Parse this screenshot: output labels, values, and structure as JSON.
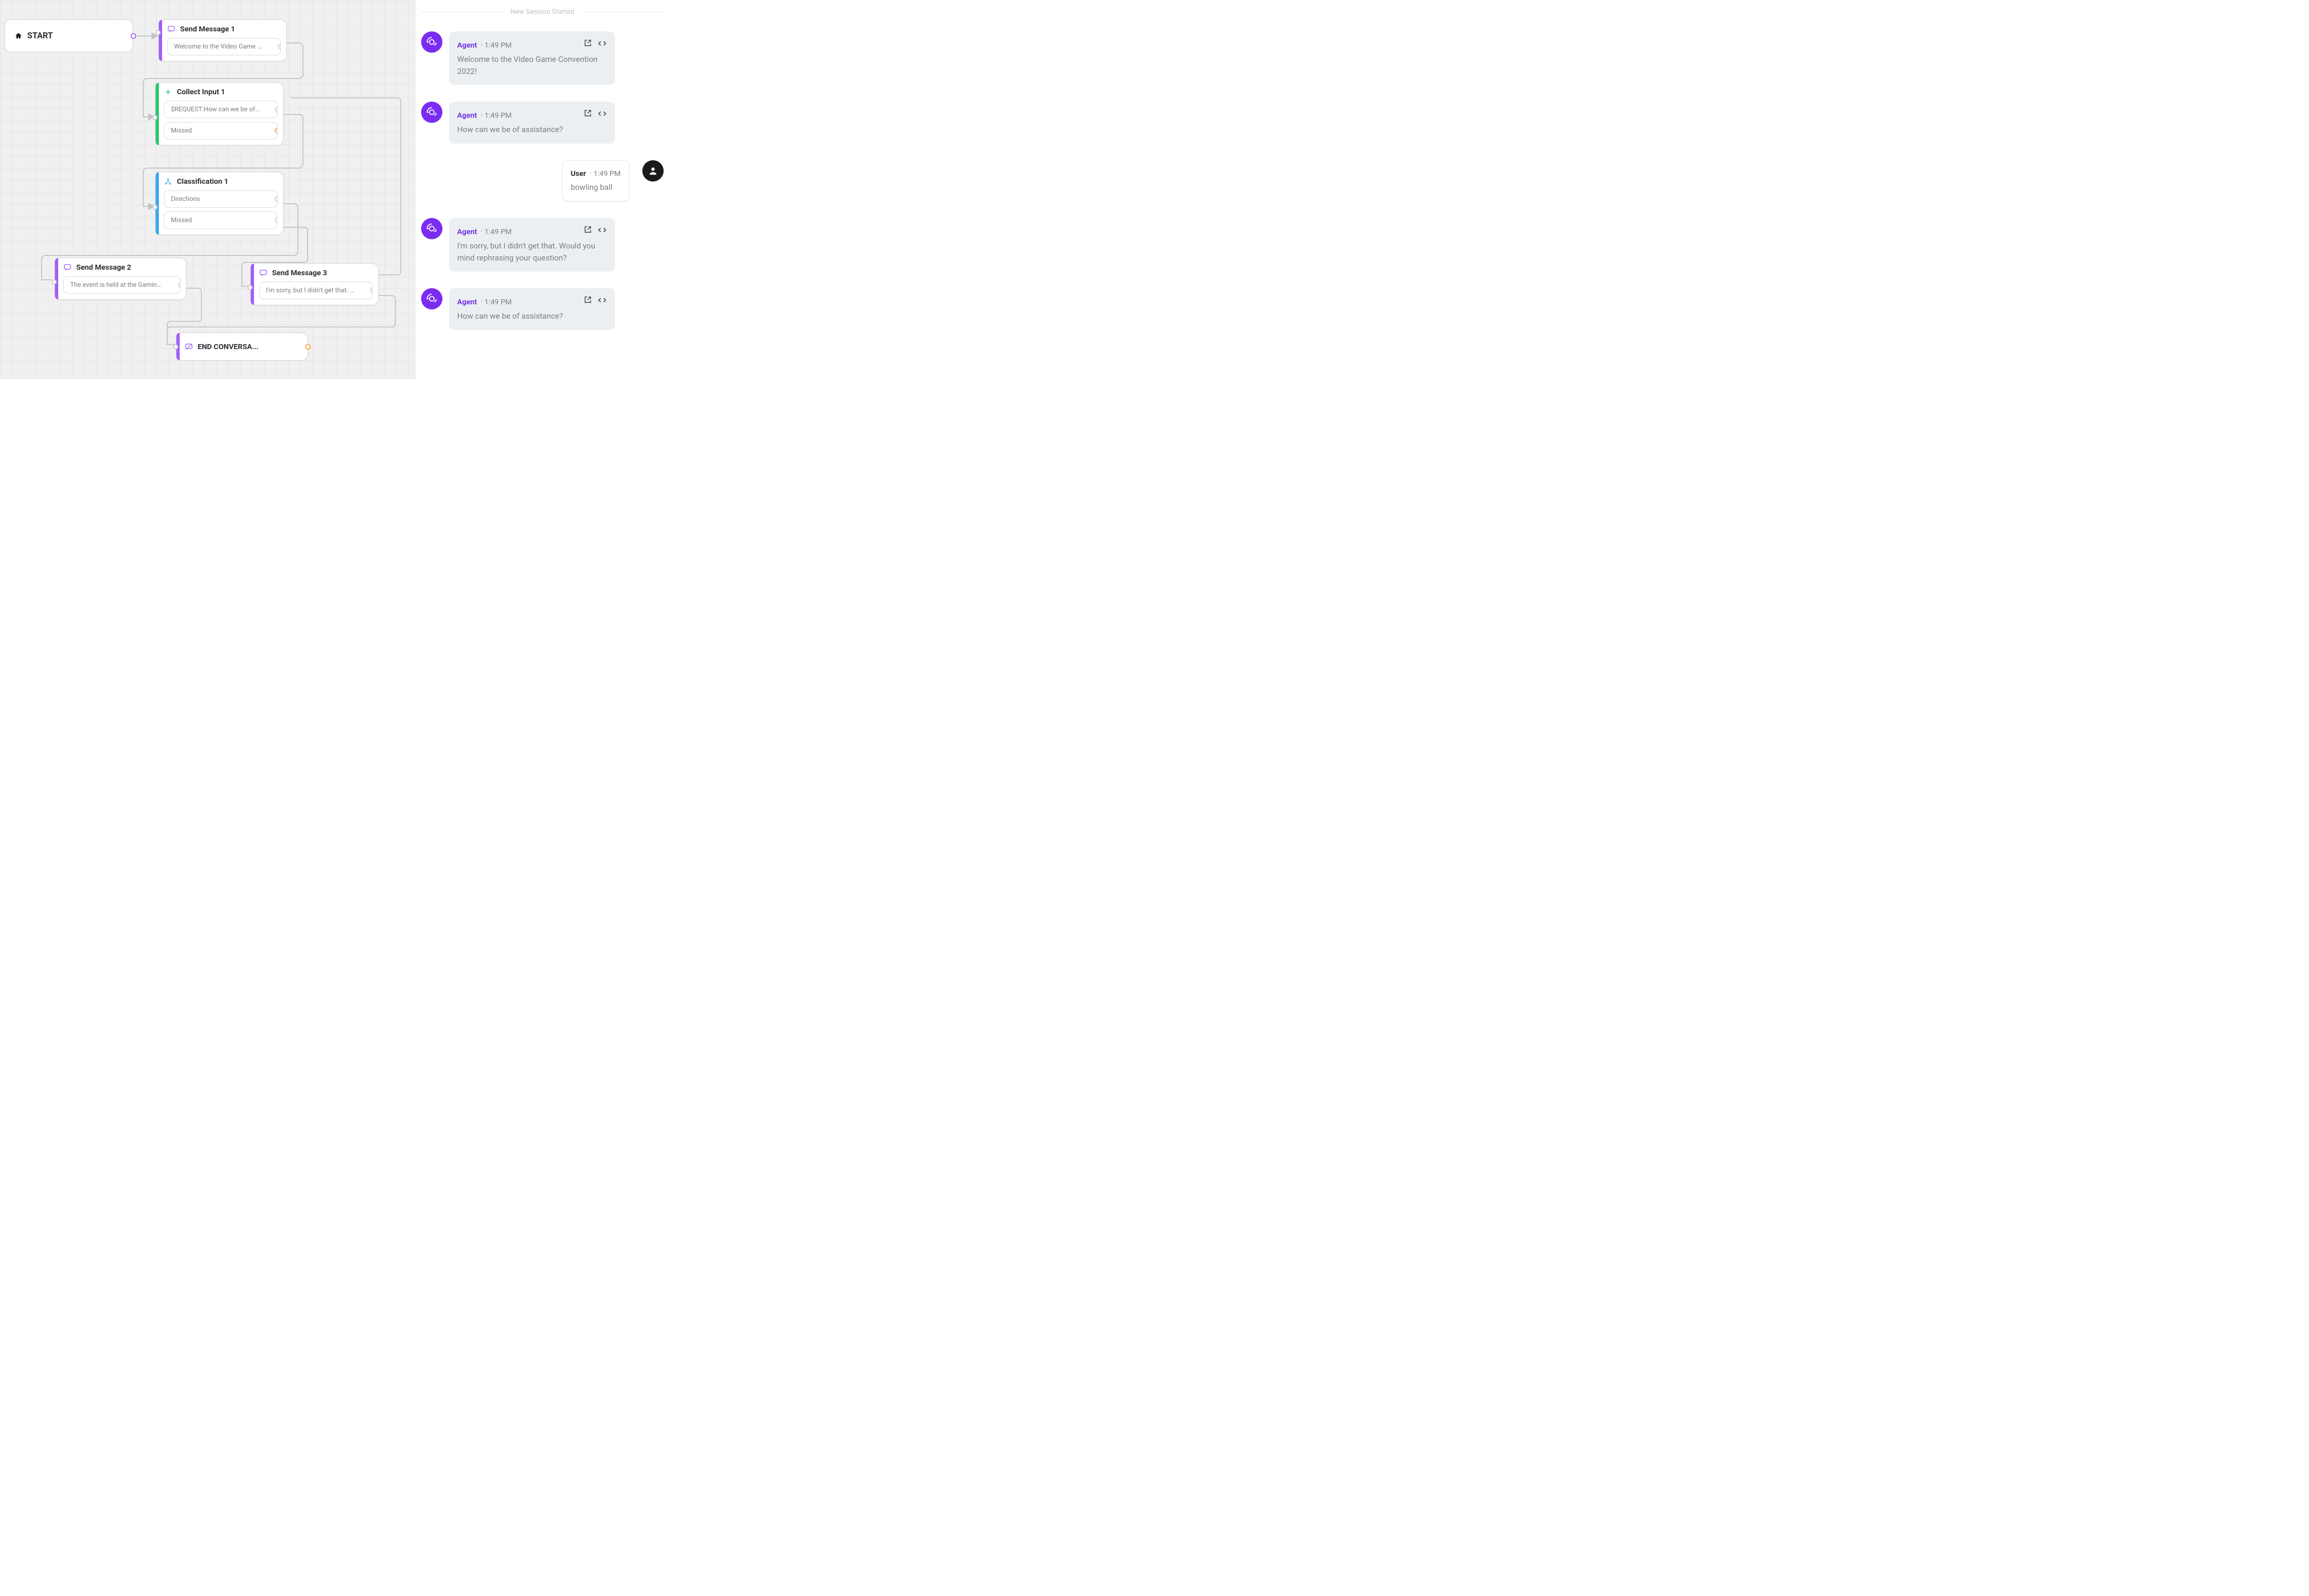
{
  "flow": {
    "start": {
      "label": "START"
    },
    "nodes": {
      "send1": {
        "title": "Send Message 1",
        "field1": "Welcome to the Video Game Co..."
      },
      "collect1": {
        "title": "Collect Input 1",
        "field1": "$REQUEST:How can we be of assis",
        "field2": "Missed"
      },
      "class1": {
        "title": "Classification 1",
        "field1": "Directions",
        "field2": "Missed"
      },
      "send2": {
        "title": "Send Message 2",
        "field1": "The event is held at the Gaming..."
      },
      "send3": {
        "title": "Send Message 3",
        "field1": "I'm sorry, but I didn't get that. ..."
      },
      "end": {
        "title": "END CONVERSA..."
      }
    }
  },
  "chat": {
    "session_label": "New Session Started",
    "messages": [
      {
        "role": "agent",
        "sender": "Agent",
        "time": "1:49 PM",
        "body": "Welcome to the Video Game Convention 2022!"
      },
      {
        "role": "agent",
        "sender": "Agent",
        "time": "1:49 PM",
        "body": "How can we be of assistance?"
      },
      {
        "role": "user",
        "sender": "User",
        "time": "1:49 PM",
        "body": "bowling ball"
      },
      {
        "role": "agent",
        "sender": "Agent",
        "time": "1:49 PM",
        "body": "I'm sorry, but I didn't get that. Would you mind rephrasing your question?"
      },
      {
        "role": "agent",
        "sender": "Agent",
        "time": "1:49 PM",
        "body": "How can we be of assistance?"
      }
    ]
  }
}
